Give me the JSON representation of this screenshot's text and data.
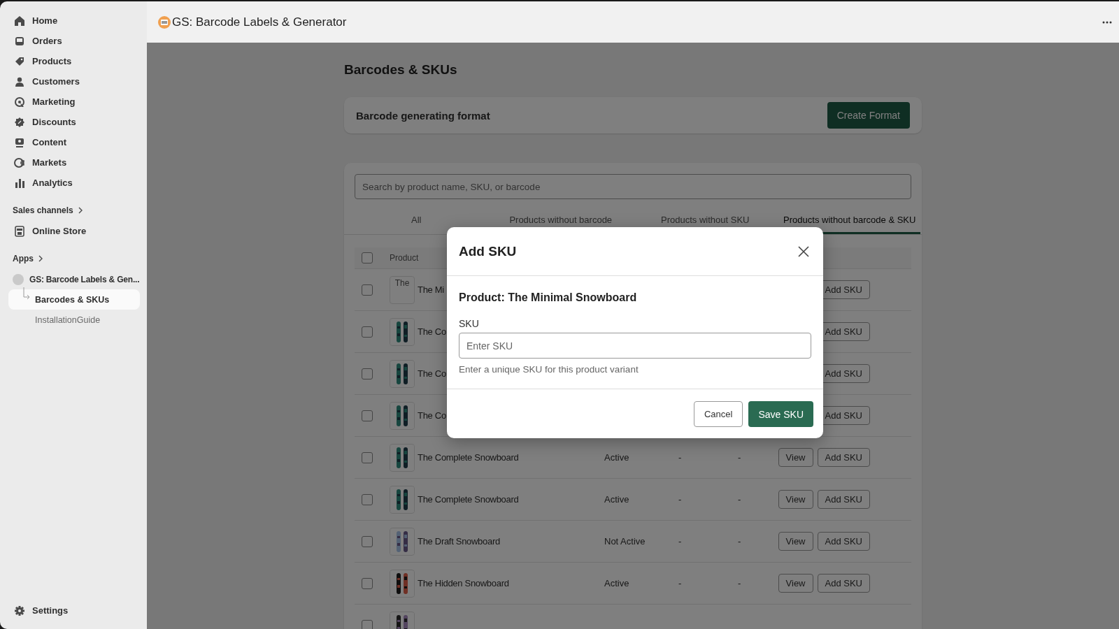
{
  "sidebar": {
    "items": [
      {
        "label": "Home",
        "selected": false
      },
      {
        "label": "Orders",
        "selected": false
      },
      {
        "label": "Products",
        "selected": false
      },
      {
        "label": "Customers",
        "selected": false
      },
      {
        "label": "Marketing",
        "selected": false
      },
      {
        "label": "Discounts",
        "selected": false
      },
      {
        "label": "Content",
        "selected": false
      },
      {
        "label": "Markets",
        "selected": false
      },
      {
        "label": "Analytics",
        "selected": false
      }
    ],
    "sales_channels": {
      "label": "Sales channels",
      "items": [
        {
          "label": "Online Store",
          "selected": false
        }
      ]
    },
    "apps": {
      "label": "Apps",
      "app": {
        "label": "GS: Barcode Labels & Gen...",
        "children": [
          {
            "label": "Barcodes & SKUs",
            "selected": true
          },
          {
            "label": "InstallationGuide",
            "selected": false
          }
        ]
      }
    },
    "settings": {
      "label": "Settings"
    }
  },
  "header": {
    "title": "GS: Barcode Labels & Generator"
  },
  "page": {
    "title": "Barcodes & SKUs",
    "format_card": {
      "title": "Barcode generating format",
      "button": "Create Format"
    },
    "search": {
      "placeholder": "Search by product name, SKU, or barcode"
    },
    "tabs": [
      {
        "label": "All",
        "selected": false
      },
      {
        "label": "Products without barcode",
        "selected": false
      },
      {
        "label": "Products without SKU",
        "selected": false
      },
      {
        "label": "Products without barcode & SKU",
        "selected": true
      }
    ],
    "table": {
      "select_all_checked": false,
      "columns": [
        "Product"
      ],
      "rows": [
        {
          "checked": false,
          "image_alt": "The",
          "name": "The Mi",
          "actions": [
            "Add SKU"
          ]
        },
        {
          "checked": false,
          "name": "The Co",
          "actions": [
            "Add SKU"
          ]
        },
        {
          "checked": false,
          "name": "The Co",
          "actions": [
            "Add SKU"
          ]
        },
        {
          "checked": false,
          "name": "The Co",
          "actions": [
            "Add SKU"
          ]
        },
        {
          "checked": false,
          "name": "The Complete Snowboard",
          "status": "Active",
          "barcode": "-",
          "sku": "-",
          "actions": [
            "View",
            "Add SKU"
          ]
        },
        {
          "checked": false,
          "name": "The Complete Snowboard",
          "status": "Active",
          "barcode": "-",
          "sku": "-",
          "actions": [
            "View",
            "Add SKU"
          ]
        },
        {
          "checked": false,
          "name": "The Draft Snowboard",
          "status": "Not Active",
          "barcode": "-",
          "sku": "-",
          "actions": [
            "View",
            "Add SKU"
          ]
        },
        {
          "checked": false,
          "name": "The Hidden Snowboard",
          "status": "Active",
          "barcode": "-",
          "sku": "-",
          "actions": [
            "View",
            "Add SKU"
          ]
        },
        {
          "checked": false
        }
      ]
    }
  },
  "modal": {
    "title": "Add SKU",
    "product": "Product: The Minimal Snowboard",
    "field": {
      "label": "SKU",
      "placeholder": "Enter SKU",
      "help": "Enter a unique SKU for this product variant"
    },
    "buttons": [
      {
        "label": "Cancel",
        "kind": "secondary"
      },
      {
        "label": "Save SKU",
        "kind": "primary"
      }
    ]
  }
}
